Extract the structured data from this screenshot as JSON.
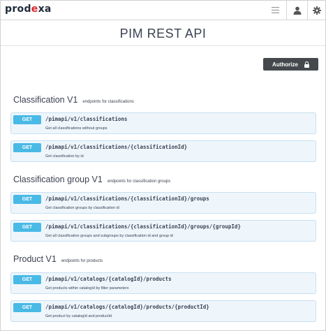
{
  "header": {
    "logo_prefix": "prod",
    "logo_mark": "e",
    "logo_suffix": "xa",
    "icons": [
      "menu-icon",
      "user-icon",
      "gear-icon"
    ]
  },
  "page_title": "PIM REST API",
  "authorize": {
    "label": "Authorize",
    "icon": "lock-icon"
  },
  "colors": {
    "get_method": "#49b9e6",
    "op_bg": "#eef6fc",
    "op_border": "#c7dff0",
    "authorize_bg": "#45494e",
    "logo_accent": "#d9262e"
  },
  "sections": [
    {
      "name": "Classification V1",
      "description": "endpoints for classifications",
      "operations": [
        {
          "method": "GET",
          "path": "/pimapi/v1/classifications",
          "summary": "Get all classifications without groups"
        },
        {
          "method": "GET",
          "path": "/pimapi/v1/classifications/{classificationId}",
          "summary": "Get classification by id"
        }
      ]
    },
    {
      "name": "Classification group V1",
      "description": "endpoints for classification groups",
      "operations": [
        {
          "method": "GET",
          "path": "/pimapi/v1/classifications/{classificationId}/groups",
          "summary": "Get classification groups by classification id"
        },
        {
          "method": "GET",
          "path": "/pimapi/v1/classifications/{classificationId}/groups/{groupId}",
          "summary": "Get all classification groups and subgroups by classification id and group id"
        }
      ]
    },
    {
      "name": "Product V1",
      "description": "endpoints for products",
      "operations": [
        {
          "method": "GET",
          "path": "/pimapi/v1/catalogs/{catalogId}/products",
          "summary": "Get products within catalogId by filter parameters"
        },
        {
          "method": "GET",
          "path": "/pimapi/v1/catalogs/{catalogId}/products/{productId}",
          "summary": "Get product by catalogId and productId"
        }
      ]
    }
  ]
}
